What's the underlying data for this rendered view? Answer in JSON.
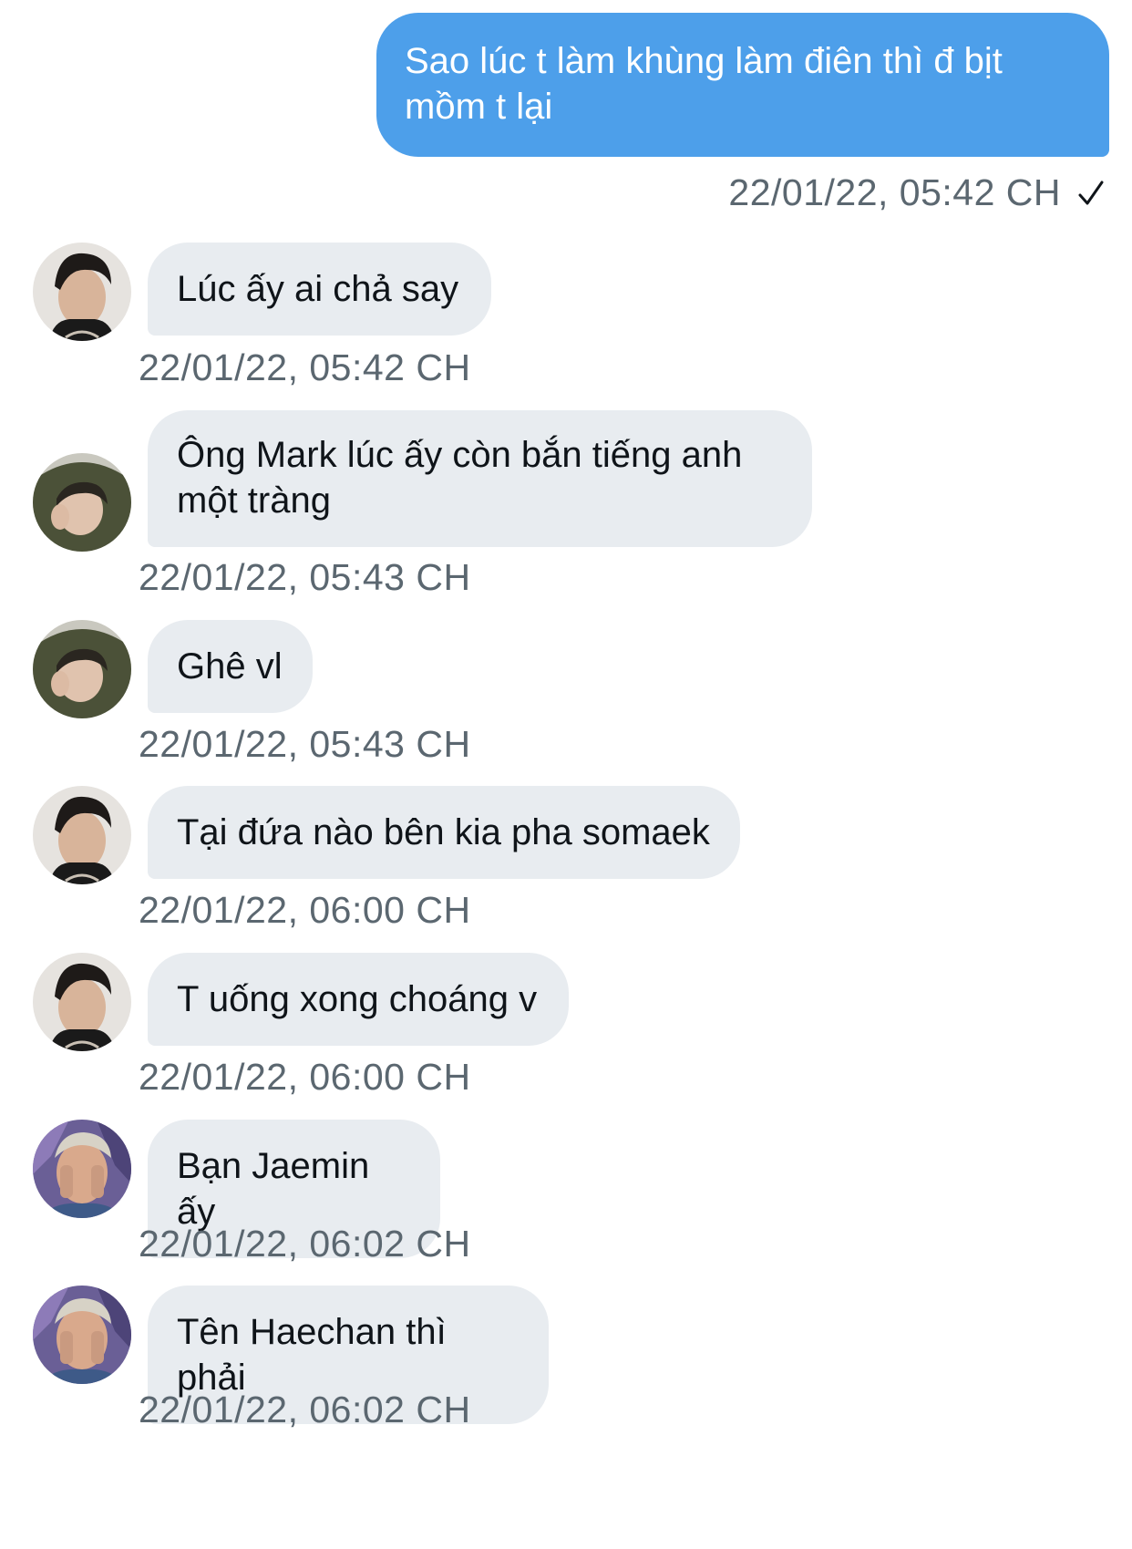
{
  "outgoing": {
    "text": "Sao lúc t làm khùng làm điên thì đ bịt mồm t lại",
    "timestamp": "22/01/22, 05:42 CH",
    "status_icon": "checkmark-icon"
  },
  "incoming": [
    {
      "avatar": "avatar-a",
      "text": "Lúc ấy ai chả say",
      "timestamp": "22/01/22, 05:42 CH"
    },
    {
      "avatar": "avatar-b",
      "text": "Ông Mark lúc ấy còn bắn tiếng anh một tràng",
      "timestamp": "22/01/22, 05:43 CH"
    },
    {
      "avatar": "avatar-b",
      "text": "Ghê vl",
      "timestamp": "22/01/22, 05:43 CH"
    },
    {
      "avatar": "avatar-a",
      "text": "Tại đứa nào bên kia pha somaek",
      "timestamp": "22/01/22, 06:00 CH"
    },
    {
      "avatar": "avatar-a",
      "text": "T uống xong choáng v",
      "timestamp": "22/01/22, 06:00 CH"
    },
    {
      "avatar": "avatar-c",
      "text": "Bạn Jaemin ấy",
      "timestamp": "22/01/22, 06:02 CH"
    },
    {
      "avatar": "avatar-c",
      "text": "Tên Haechan thì phải",
      "timestamp": "22/01/22, 06:02 CH"
    }
  ],
  "colors": {
    "outgoing_bubble": "#4d9fea",
    "incoming_bubble": "#e8ecf0",
    "timestamp": "#5b6770"
  }
}
